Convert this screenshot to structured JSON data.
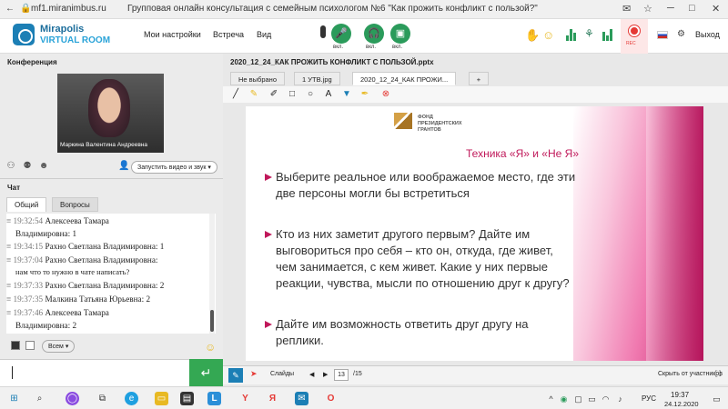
{
  "browser": {
    "url": "mf1.miranimbus.ru",
    "title": "Групповая онлайн консультация с семейным психологом №6 \"Как прожить конфликт с пользой?\""
  },
  "header": {
    "logo_line1": "Mirapolis",
    "logo_line2": "VIRTUAL ROOM",
    "menu": [
      "Мои настройки",
      "Встреча",
      "Вид"
    ],
    "toggle_labels": [
      "вкл.",
      "вкл.",
      "вкл."
    ],
    "rec_label": "REC",
    "exit_label": "Выход"
  },
  "left": {
    "conference_title": "Конференция",
    "video_name": "Маркина Валентина  Андреевна",
    "start_video_label": "Запустить видео и звук",
    "chat_title": "Чат",
    "tabs": [
      "Общий",
      "Вопросы"
    ],
    "messages": [
      {
        "time": "19:32:54",
        "text": "Алексеева   Тамара"
      },
      {
        "time": "",
        "text": "Владимировна: 1"
      },
      {
        "time": "19:34:15",
        "text": "Рахно Светлана  Владимировна: 1"
      },
      {
        "time": "19:37:04",
        "text": "Рахно Светлана  Владимировна:"
      },
      {
        "time": "",
        "text": "нам что то нужно в чате написать?"
      },
      {
        "time": "19:37:33",
        "text": "Рахно Светлана  Владимировна: 2"
      },
      {
        "time": "19:37:35",
        "text": "Малкина Татьяна  Юрьевна: 2"
      },
      {
        "time": "19:37:46",
        "text": "Алексеева   Тамара"
      },
      {
        "time": "",
        "text": "Владимировна: 2"
      }
    ],
    "recipient": "Всем",
    "input_value": ""
  },
  "main": {
    "file_title": "2020_12_24_КАК ПРОЖИТЬ КОНФЛИКТ С ПОЛЬЗОЙ.pptx",
    "doc_tabs": [
      "Не выбрано",
      "1 УТВ.jpg",
      "2020_12_24_КАК ПРОЖИ...",
      "+"
    ],
    "slide": {
      "fund_line1": "ФОНД",
      "fund_line2": "ПРЕЗИДЕНТСКИХ",
      "fund_line3": "ГРАНТОВ",
      "title": "Техника «Я» и «Не Я»",
      "bullets": [
        [
          "Выберите реальное или воображаемое место, где эти",
          "две персоны могли бы встретиться"
        ],
        [
          "Кто из них заметит другого первым? Дайте им",
          "выговориться про себя – кто он, откуда, где живет,",
          "чем занимается, с кем живет. Какие у них первые",
          "реакции, чувства, мысли по отношению друг к другу?"
        ],
        [
          "Дайте им возможность ответить друг другу на",
          "реплики."
        ]
      ]
    },
    "bottom": {
      "slides_label": "Слайды",
      "current_page": "13",
      "total_pages": "/15",
      "hide_label": "Скрыть от участников"
    }
  },
  "taskbar": {
    "lang": "РУС",
    "time": "19:37",
    "date": "24.12.2020"
  },
  "colors": {
    "accent_green": "#34a853",
    "slide_pink": "#c0185a",
    "brand_blue": "#1c7fb5"
  }
}
